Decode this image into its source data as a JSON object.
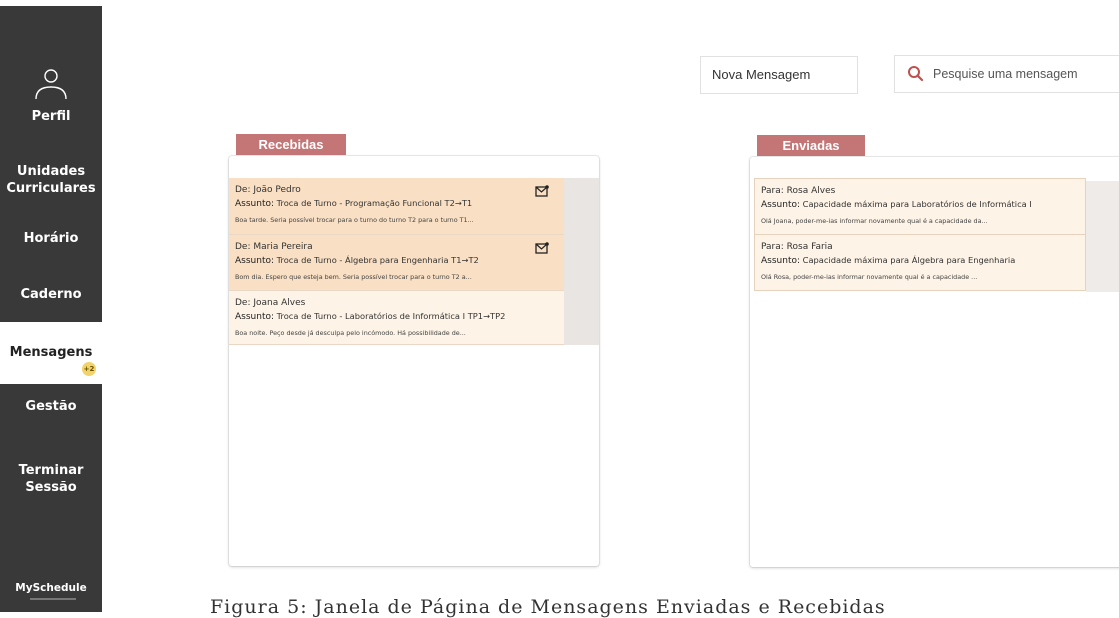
{
  "sidebar": {
    "items": [
      {
        "label": "Perfil"
      },
      {
        "label": "Unidades Curriculares"
      },
      {
        "label": "Horário"
      },
      {
        "label": "Caderno"
      },
      {
        "label": "Mensagens",
        "badge": "+2"
      },
      {
        "label": "Gestão"
      },
      {
        "label": "Terminar Sessão"
      }
    ],
    "logo": "MySchedule",
    "active_color": "#ffffff",
    "background": "#393939"
  },
  "toolbar": {
    "new_message_label": "Nova Mensagem",
    "search_placeholder": "Pesquise uma mensagem",
    "search_icon": "search-icon"
  },
  "received": {
    "title": "Recebidas",
    "messages": [
      {
        "from_label": "De:",
        "from": "João Pedro",
        "subject_label": "Assunto:",
        "subject": "Troca de Turno -  Programação Funcional T2→T1",
        "preview": "Boa tarde. Seria possível trocar para o turno do turno T2 para o turno T1...",
        "unread": true
      },
      {
        "from_label": "De:",
        "from": "Maria Pereira",
        "subject_label": "Assunto:",
        "subject": "Troca de Turno -  Álgebra para Engenharia T1→T2",
        "preview": "Bom dia. Espero que esteja bem. Seria possível trocar para o turno T2 a...",
        "unread": true
      },
      {
        "from_label": "De:",
        "from": "Joana Alves",
        "subject_label": "Assunto:",
        "subject": "Troca de Turno -  Laboratórios de Informática I TP1→TP2",
        "preview": "Boa noite. Peço desde já desculpa pelo incómodo. Há possibilidade de...",
        "unread": false
      }
    ]
  },
  "sent": {
    "title": "Enviadas",
    "messages": [
      {
        "to_label": "Para:",
        "to": "Rosa Alves",
        "subject_label": "Assunto:",
        "subject": "Capacidade máxima para Laboratórios de Informática I",
        "preview": "Olá Joana, poder-me-ias informar novamente qual é a capacidade da..."
      },
      {
        "to_label": "Para:",
        "to": "Rosa Faria",
        "subject_label": "Assunto:",
        "subject": "Capacidade máxima para Álgebra para Engenharia",
        "preview": "Olá Rosa, poder-me-ias informar novamente qual é a capacidade ..."
      }
    ]
  },
  "caption": "Figura 5: Janela de Página de Mensagens Enviadas e Recebidas",
  "colors": {
    "label_bg": "#c47677",
    "unread_bg": "#f9dfc3",
    "read_bg": "#fdf3e6"
  }
}
